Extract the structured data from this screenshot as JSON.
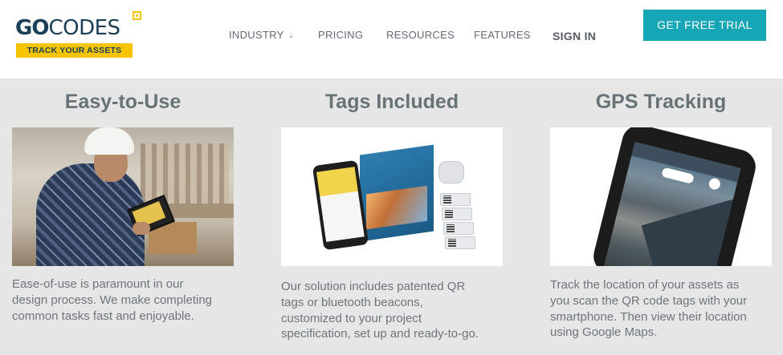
{
  "header": {
    "logo": {
      "word_go": "GO",
      "word_codes": "CODES",
      "tagline": "TRACK YOUR ASSETS"
    },
    "nav": [
      {
        "label": "INDUSTRY",
        "has_dropdown": true
      },
      {
        "label": "PRICING",
        "has_dropdown": false
      },
      {
        "label": "RESOURCES",
        "has_dropdown": false
      },
      {
        "label": "FEATURES",
        "has_dropdown": false
      },
      {
        "label": "SIGN IN",
        "has_dropdown": false
      }
    ],
    "cta_label": "GET FREE TRIAL",
    "dropdown_icon": "chevron-down-icon"
  },
  "colors": {
    "brand_navy": "#1b3f57",
    "brand_yellow": "#f5c400",
    "cta_teal": "#17a6b5",
    "page_background": "#e6e6e6"
  },
  "features": [
    {
      "title": "Easy-to-Use",
      "image": "worker-using-tablet-photo",
      "text": "Ease-of-use is paramount in our design process. We make completing common tasks fast and enjoyable."
    },
    {
      "title": "Tags Included",
      "image": "qr-tags-and-welcome-kit-photo",
      "text": "Our solution includes patented QR tags or bluetooth beacons, customized to your project specification, set up and ready-to-go."
    },
    {
      "title": "GPS Tracking",
      "image": "smartphone-map-photo",
      "text": "Track the location of your assets as you scan the QR code tags with your smartphone. Then view their location using Google Maps."
    }
  ]
}
